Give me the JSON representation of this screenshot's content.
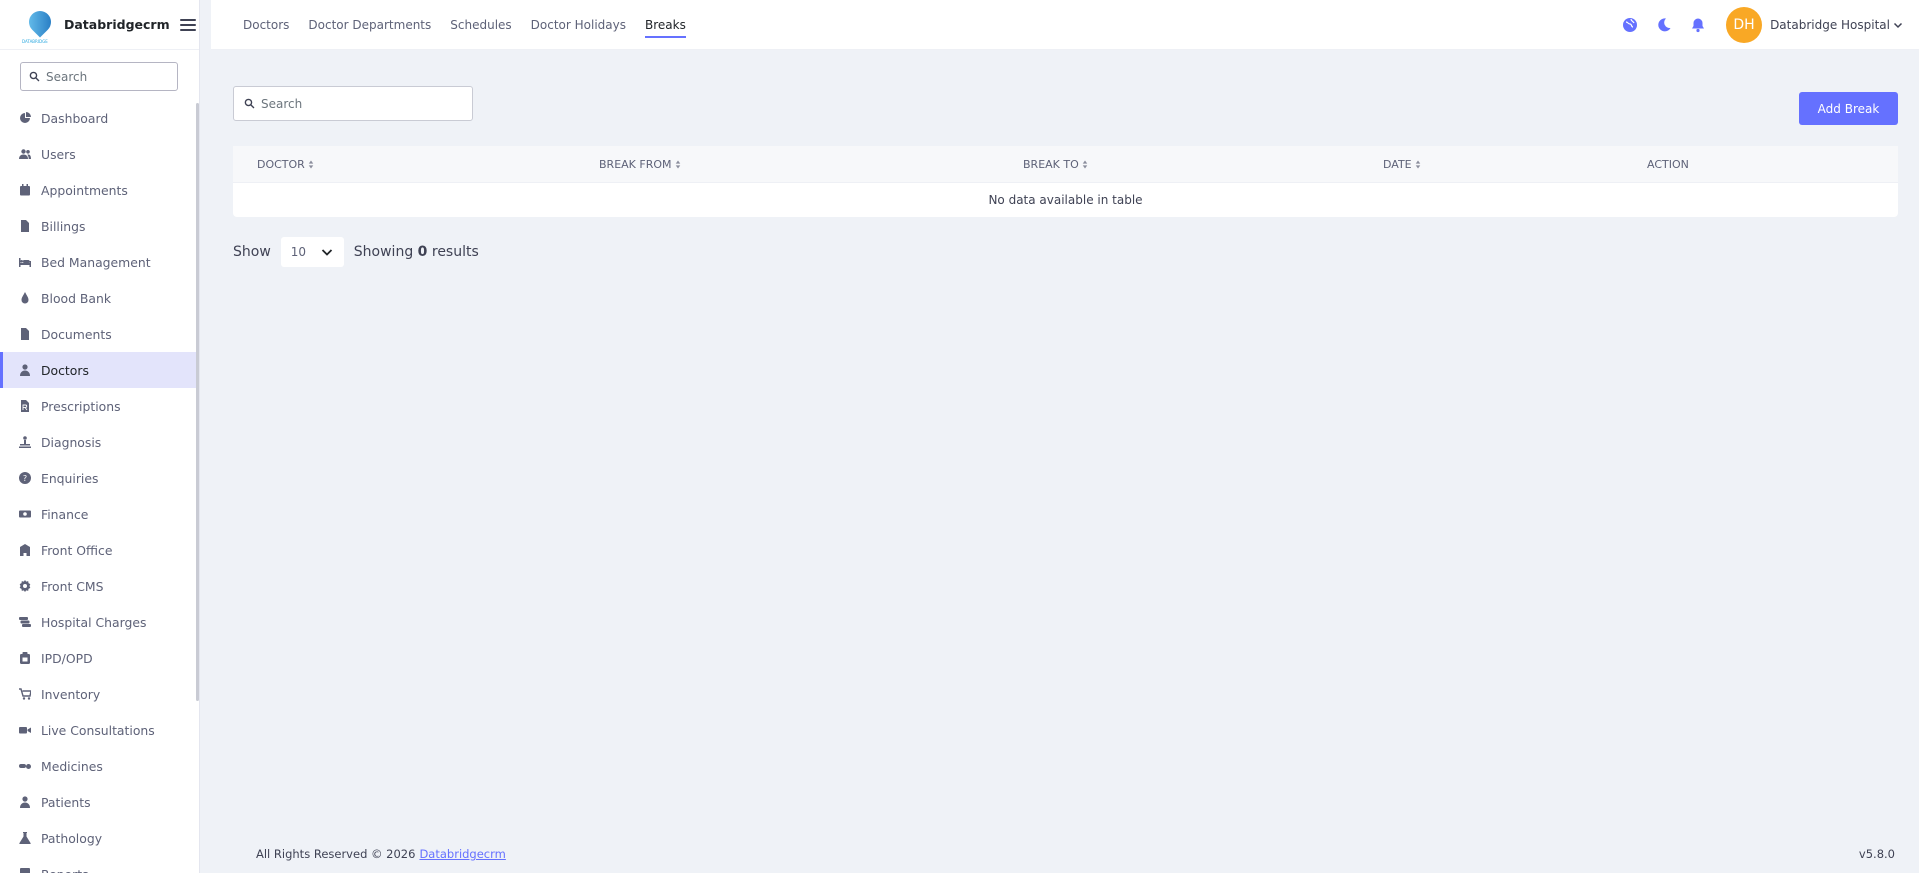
{
  "brand": {
    "name": "Databridgecrm",
    "logo_tag": "DATABRIDGE"
  },
  "sidebar": {
    "search_placeholder": "Search",
    "items": [
      {
        "label": "Dashboard",
        "icon": "dashboard-icon"
      },
      {
        "label": "Users",
        "icon": "users-icon"
      },
      {
        "label": "Appointments",
        "icon": "calendar-icon"
      },
      {
        "label": "Billings",
        "icon": "file-invoice-icon"
      },
      {
        "label": "Bed Management",
        "icon": "bed-icon"
      },
      {
        "label": "Blood Bank",
        "icon": "blood-drop-icon"
      },
      {
        "label": "Documents",
        "icon": "document-icon"
      },
      {
        "label": "Doctors",
        "icon": "doctor-icon",
        "active": true
      },
      {
        "label": "Prescriptions",
        "icon": "prescription-icon"
      },
      {
        "label": "Diagnosis",
        "icon": "diagnosis-icon"
      },
      {
        "label": "Enquiries",
        "icon": "question-circle-icon"
      },
      {
        "label": "Finance",
        "icon": "money-icon"
      },
      {
        "label": "Front Office",
        "icon": "building-icon"
      },
      {
        "label": "Front CMS",
        "icon": "gear-icon"
      },
      {
        "label": "Hospital Charges",
        "icon": "coins-icon"
      },
      {
        "label": "IPD/OPD",
        "icon": "clipboard-icon"
      },
      {
        "label": "Inventory",
        "icon": "cart-icon"
      },
      {
        "label": "Live Consultations",
        "icon": "video-icon"
      },
      {
        "label": "Medicines",
        "icon": "pills-icon"
      },
      {
        "label": "Patients",
        "icon": "patient-icon"
      },
      {
        "label": "Pathology",
        "icon": "flask-icon"
      },
      {
        "label": "Reports",
        "icon": "report-icon"
      }
    ]
  },
  "topbar": {
    "tabs": [
      {
        "label": "Doctors"
      },
      {
        "label": "Doctor Departments"
      },
      {
        "label": "Schedules"
      },
      {
        "label": "Doctor Holidays"
      },
      {
        "label": "Breaks",
        "active": true
      }
    ],
    "user_initials": "DH",
    "user_name": "Databridge Hospital"
  },
  "main": {
    "search_placeholder": "Search",
    "add_button": "Add Break",
    "columns": [
      "DOCTOR",
      "BREAK FROM",
      "BREAK TO",
      "DATE",
      "ACTION"
    ],
    "empty_message": "No data available in table",
    "show_label": "Show",
    "per_page": "10",
    "showing_prefix": "Showing",
    "showing_count": "0",
    "showing_suffix": "results"
  },
  "footer": {
    "copyright": "All Rights Reserved © 2026",
    "link": "Databridgecrm",
    "version": "v5.8.0"
  },
  "colors": {
    "accent": "#6571ff",
    "avatar": "#f9a825",
    "background": "#eff2f7"
  }
}
